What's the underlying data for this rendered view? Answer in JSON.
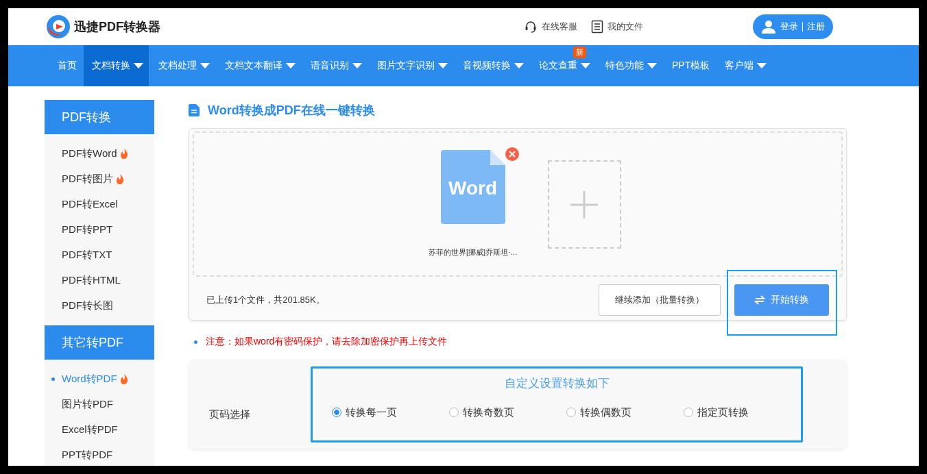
{
  "header": {
    "brand": "迅捷PDF转换器",
    "links": [
      {
        "kind": "headset",
        "label": "在线客服"
      },
      {
        "kind": "file",
        "label": "我的文件"
      }
    ],
    "login": "登录",
    "register": "注册"
  },
  "nav": [
    {
      "label": "首页",
      "selected": false,
      "dropdown": false
    },
    {
      "label": "文档转换",
      "selected": true,
      "dropdown": true
    },
    {
      "label": "文档处理",
      "selected": false,
      "dropdown": true
    },
    {
      "label": "文档文本翻译",
      "selected": false,
      "dropdown": true
    },
    {
      "label": "语音识别",
      "selected": false,
      "dropdown": true
    },
    {
      "label": "图片文字识别",
      "selected": false,
      "dropdown": true
    },
    {
      "label": "音视频转换",
      "selected": false,
      "dropdown": true
    },
    {
      "label": "论文查重",
      "selected": false,
      "dropdown": true,
      "badge": "新"
    },
    {
      "label": "特色功能",
      "selected": false,
      "dropdown": true
    },
    {
      "label": "PPT模板",
      "selected": false,
      "dropdown": false
    },
    {
      "label": "客户端",
      "selected": false,
      "dropdown": true
    }
  ],
  "sidebar": [
    {
      "title": "PDF转换",
      "items": [
        {
          "label": "PDF转Word",
          "hot": true,
          "selected": false
        },
        {
          "label": "PDF转图片",
          "hot": true,
          "selected": false
        },
        {
          "label": "PDF转Excel",
          "hot": false,
          "selected": false
        },
        {
          "label": "PDF转PPT",
          "hot": false,
          "selected": false
        },
        {
          "label": "PDF转TXT",
          "hot": false,
          "selected": false
        },
        {
          "label": "PDF转HTML",
          "hot": false,
          "selected": false
        },
        {
          "label": "PDF转长图",
          "hot": false,
          "selected": false
        }
      ]
    },
    {
      "title": "其它转PDF",
      "items": [
        {
          "label": "Word转PDF",
          "hot": true,
          "selected": true
        },
        {
          "label": "图片转PDF",
          "hot": false,
          "selected": false
        },
        {
          "label": "Excel转PDF",
          "hot": false,
          "selected": false
        },
        {
          "label": "PPT转PDF",
          "hot": false,
          "selected": false
        }
      ]
    }
  ],
  "main": {
    "title": "Word转换成PDF在线一键转换",
    "upload": {
      "file": {
        "type_label": "Word",
        "name": "苏菲的世界[挪威]乔斯坦·..."
      },
      "summary": "已上传1个文件，共201.85K。",
      "add_button": "继续添加（批量转换）",
      "start_button": "开始转换",
      "start_highlighted": true
    },
    "note": "注意：如果word有密码保护，请去除加密保护再上传文件",
    "settings": {
      "heading": "自定义设置转换如下",
      "label": "页码选择",
      "options": [
        {
          "label": "转换每一页",
          "selected": true
        },
        {
          "label": "转换奇数页",
          "selected": false
        },
        {
          "label": "转换偶数页",
          "selected": false
        },
        {
          "label": "指定页转换",
          "selected": false
        }
      ]
    }
  }
}
